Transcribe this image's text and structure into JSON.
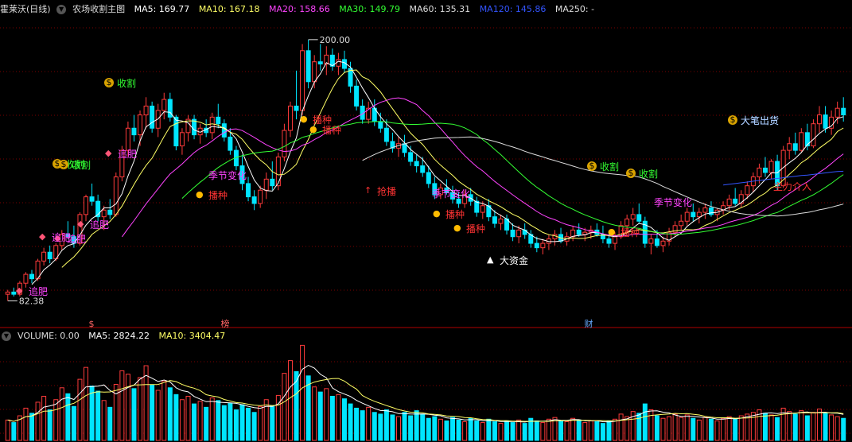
{
  "price_header": {
    "stock_name": "霍莱沃(日线)",
    "indicator": "农场收割主图",
    "ma5": "MA5: 169.77",
    "ma10": "MA10: 167.18",
    "ma20": "MA20: 158.66",
    "ma30": "MA30: 149.79",
    "ma60": "MA60: 135.31",
    "ma120": "MA120: 145.86",
    "ma250": "MA250: -"
  },
  "volume_header": {
    "volume": "VOLUME: 0.00",
    "ma5": "MA5: 2824.22",
    "ma10": "MA10: 3404.47"
  },
  "colors": {
    "background": "#000000",
    "up": "#ff3b3b",
    "down": "#00e5ff",
    "ma5": "#ffffff",
    "ma10": "#ffff66",
    "ma20": "#ff44ff",
    "ma30": "#33ff33",
    "ma60": "#dddddd",
    "ma120": "#3355ff",
    "grid": "#7a0000"
  },
  "chart_data": [
    {
      "type": "candlestick",
      "title": "农场收割主图",
      "ylim": [
        75,
        210
      ],
      "price_labels": {
        "high": "200.00",
        "low": "82.38"
      },
      "candles": [
        [
          85,
          87,
          82,
          86
        ],
        [
          86,
          88,
          84,
          85
        ],
        [
          85,
          91,
          84,
          90
        ],
        [
          90,
          95,
          88,
          94
        ],
        [
          94,
          96,
          90,
          92
        ],
        [
          92,
          101,
          91,
          100
        ],
        [
          100,
          106,
          98,
          104
        ],
        [
          104,
          107,
          99,
          101
        ],
        [
          101,
          108,
          100,
          107
        ],
        [
          107,
          114,
          105,
          112
        ],
        [
          112,
          118,
          110,
          111
        ],
        [
          111,
          116,
          106,
          108
        ],
        [
          108,
          122,
          107,
          121
        ],
        [
          121,
          130,
          118,
          129
        ],
        [
          129,
          135,
          125,
          127
        ],
        [
          127,
          130,
          118,
          120
        ],
        [
          120,
          125,
          114,
          123
        ],
        [
          123,
          128,
          119,
          121
        ],
        [
          121,
          140,
          120,
          138
        ],
        [
          138,
          152,
          136,
          150
        ],
        [
          150,
          163,
          147,
          160
        ],
        [
          160,
          166,
          154,
          157
        ],
        [
          157,
          168,
          152,
          166
        ],
        [
          166,
          174,
          160,
          170
        ],
        [
          170,
          172,
          158,
          160
        ],
        [
          160,
          171,
          156,
          168
        ],
        [
          168,
          176,
          164,
          173
        ],
        [
          173,
          176,
          163,
          165
        ],
        [
          165,
          166,
          150,
          152
        ],
        [
          152,
          160,
          148,
          158
        ],
        [
          158,
          166,
          154,
          164
        ],
        [
          164,
          166,
          155,
          157
        ],
        [
          157,
          162,
          153,
          160
        ],
        [
          160,
          164,
          156,
          158
        ],
        [
          158,
          167,
          155,
          165
        ],
        [
          165,
          171,
          160,
          162
        ],
        [
          162,
          164,
          154,
          156
        ],
        [
          156,
          160,
          148,
          150
        ],
        [
          150,
          152,
          141,
          143
        ],
        [
          143,
          148,
          132,
          135
        ],
        [
          135,
          138,
          127,
          129
        ],
        [
          129,
          132,
          123,
          126
        ],
        [
          126,
          134,
          124,
          132
        ],
        [
          132,
          140,
          128,
          137
        ],
        [
          137,
          145,
          132,
          134
        ],
        [
          134,
          149,
          132,
          147
        ],
        [
          147,
          162,
          145,
          159
        ],
        [
          159,
          172,
          156,
          170
        ],
        [
          170,
          186,
          164,
          168
        ],
        [
          168,
          198,
          166,
          195
        ],
        [
          195,
          200,
          178,
          181
        ],
        [
          181,
          193,
          178,
          190
        ],
        [
          190,
          198,
          186,
          189
        ],
        [
          189,
          197,
          184,
          193
        ],
        [
          193,
          196,
          186,
          188
        ],
        [
          188,
          194,
          184,
          191
        ],
        [
          191,
          195,
          185,
          187
        ],
        [
          187,
          190,
          176,
          179
        ],
        [
          179,
          182,
          168,
          170
        ],
        [
          170,
          173,
          162,
          164
        ],
        [
          164,
          172,
          162,
          169
        ],
        [
          169,
          173,
          161,
          163
        ],
        [
          163,
          167,
          158,
          160
        ],
        [
          160,
          164,
          152,
          154
        ],
        [
          154,
          158,
          149,
          151
        ],
        [
          151,
          156,
          147,
          153
        ],
        [
          153,
          157,
          147,
          149
        ],
        [
          149,
          152,
          143,
          145
        ],
        [
          145,
          148,
          140,
          143
        ],
        [
          143,
          147,
          138,
          140
        ],
        [
          140,
          143,
          133,
          135
        ],
        [
          135,
          138,
          128,
          130
        ],
        [
          130,
          135,
          128,
          133
        ],
        [
          133,
          137,
          130,
          131
        ],
        [
          131,
          134,
          126,
          128
        ],
        [
          128,
          131,
          124,
          126
        ],
        [
          126,
          132,
          124,
          130
        ],
        [
          130,
          133,
          125,
          127
        ],
        [
          127,
          129,
          120,
          122
        ],
        [
          122,
          127,
          119,
          125
        ],
        [
          125,
          128,
          118,
          120
        ],
        [
          120,
          123,
          115,
          117
        ],
        [
          117,
          121,
          114,
          119
        ],
        [
          119,
          121,
          112,
          114
        ],
        [
          114,
          117,
          109,
          111
        ],
        [
          111,
          116,
          108,
          114
        ],
        [
          114,
          117,
          110,
          112
        ],
        [
          112,
          114,
          106,
          108
        ],
        [
          108,
          111,
          104,
          106
        ],
        [
          106,
          110,
          103,
          108
        ],
        [
          108,
          112,
          105,
          110
        ],
        [
          110,
          114,
          107,
          112
        ],
        [
          112,
          115,
          108,
          109
        ],
        [
          109,
          113,
          107,
          111
        ],
        [
          111,
          116,
          109,
          114
        ],
        [
          114,
          117,
          111,
          112
        ],
        [
          112,
          115,
          109,
          113
        ],
        [
          113,
          116,
          110,
          114
        ],
        [
          114,
          117,
          111,
          112
        ],
        [
          112,
          116,
          108,
          110
        ],
        [
          110,
          113,
          106,
          108
        ],
        [
          108,
          113,
          105,
          111
        ],
        [
          111,
          118,
          110,
          116
        ],
        [
          116,
          121,
          113,
          119
        ],
        [
          119,
          124,
          116,
          121
        ],
        [
          121,
          126,
          117,
          118
        ],
        [
          118,
          120,
          106,
          108
        ],
        [
          108,
          112,
          103,
          110
        ],
        [
          110,
          114,
          106,
          107
        ],
        [
          107,
          111,
          104,
          109
        ],
        [
          109,
          115,
          107,
          113
        ],
        [
          113,
          118,
          111,
          116
        ],
        [
          116,
          121,
          114,
          118
        ],
        [
          118,
          124,
          116,
          122
        ],
        [
          122,
          126,
          118,
          120
        ],
        [
          120,
          124,
          117,
          122
        ],
        [
          122,
          126,
          119,
          124
        ],
        [
          124,
          127,
          120,
          121
        ],
        [
          121,
          124,
          118,
          123
        ],
        [
          123,
          127,
          121,
          125
        ],
        [
          125,
          130,
          123,
          128
        ],
        [
          128,
          133,
          125,
          126
        ],
        [
          126,
          132,
          124,
          130
        ],
        [
          130,
          136,
          128,
          134
        ],
        [
          134,
          140,
          131,
          138
        ],
        [
          138,
          144,
          135,
          142
        ],
        [
          142,
          147,
          138,
          140
        ],
        [
          140,
          146,
          137,
          145
        ],
        [
          145,
          148,
          132,
          134
        ],
        [
          134,
          152,
          133,
          150
        ],
        [
          150,
          156,
          146,
          153
        ],
        [
          153,
          158,
          148,
          150
        ],
        [
          150,
          160,
          149,
          158
        ],
        [
          158,
          162,
          150,
          152
        ],
        [
          152,
          164,
          151,
          162
        ],
        [
          162,
          170,
          158,
          166
        ],
        [
          166,
          170,
          158,
          160
        ],
        [
          160,
          168,
          157,
          165
        ],
        [
          165,
          172,
          162,
          169
        ],
        [
          169,
          174,
          163,
          166
        ]
      ],
      "volume": [
        2400,
        2100,
        2900,
        3800,
        3200,
        4500,
        5200,
        3600,
        4800,
        6200,
        5500,
        4000,
        7200,
        8600,
        6400,
        5800,
        4700,
        3900,
        6600,
        8200,
        7800,
        6100,
        7400,
        8800,
        6500,
        5900,
        7000,
        6200,
        5400,
        4800,
        5200,
        4300,
        4600,
        3900,
        5000,
        4700,
        4100,
        4400,
        3600,
        4200,
        3800,
        3300,
        4000,
        4800,
        4100,
        5300,
        7900,
        9400,
        8100,
        11200,
        7600,
        6300,
        5700,
        6100,
        5200,
        5400,
        4900,
        4300,
        3800,
        3500,
        3900,
        3300,
        3100,
        3600,
        3000,
        2800,
        3300,
        2900,
        3500,
        3100,
        2600,
        2800,
        2500,
        2300,
        2700,
        2400,
        2200,
        2600,
        2300,
        2100,
        2500,
        2200,
        2000,
        2300,
        2100,
        2400,
        2000,
        2600,
        2300,
        2100,
        2500,
        2700,
        2300,
        2200,
        2600,
        2400,
        2100,
        2300,
        2200,
        2000,
        2300,
        2500,
        3100,
        2800,
        3400,
        3200,
        4300,
        3600,
        2900,
        2600,
        2800,
        3100,
        2700,
        3000,
        2600,
        2400,
        2700,
        2500,
        2300,
        2600,
        2800,
        2500,
        2900,
        3100,
        3300,
        3600,
        3200,
        3000,
        2700,
        3800,
        3400,
        3100,
        3500,
        2900,
        3300,
        3700,
        3200,
        3000,
        2800,
        2600
      ],
      "ma_series": [
        {
          "name": "MA5",
          "value": 169.77
        },
        {
          "name": "MA10",
          "value": 167.18
        },
        {
          "name": "MA20",
          "value": 158.66
        },
        {
          "name": "MA30",
          "value": 149.79
        },
        {
          "name": "MA60",
          "value": 135.31
        },
        {
          "name": "MA120",
          "value": 145.86
        },
        {
          "name": "MA250",
          "value": "-"
        }
      ],
      "bottom_markers": [
        "$",
        "榜",
        "财"
      ],
      "annotations": [
        {
          "text": "收割",
          "i": 28,
          "price": 124,
          "color": "#33ff33",
          "icon": "money-bag-icon"
        },
        {
          "text": "追肥",
          "i": 30,
          "price": 132,
          "color": "#ff44ff",
          "icon": "diamond-icon"
        },
        {
          "text": "收割",
          "i": 12,
          "price": 164,
          "color": "#33ff33",
          "icon": "money-bag-icon"
        },
        {
          "text": "追肥",
          "i": 6,
          "price": 180,
          "color": "#ff44ff",
          "icon": "diamond-icon"
        },
        {
          "text": "追肥",
          "i": 2,
          "price": 202,
          "color": "#ff44ff",
          "icon": "diamond-icon"
        },
        {
          "text": "收割",
          "i": 2,
          "price": 215,
          "color": "#33ff33",
          "icon": "money-bag-icon"
        },
        {
          "text": "追肥",
          "i": 5,
          "price": 232,
          "color": "#ff44ff",
          "icon": "diamond-icon"
        },
        {
          "text": "追肥",
          "i": 0,
          "price": 298,
          "color": "#ff44ff",
          "icon": "diamond-icon"
        },
        {
          "text": "季节变化",
          "i": 0,
          "price": 220,
          "color": "#ff44ff",
          "icon": ""
        },
        {
          "text": "播种",
          "i": 0,
          "price": 245,
          "color": "#ff3333",
          "icon": "fruit-icon"
        },
        {
          "text": "大笔出货",
          "i": 0,
          "price": 77,
          "color": "#aaccff",
          "icon": "money-bag-icon"
        },
        {
          "text": "播种",
          "i": 0,
          "price": 150,
          "color": "#ff3333",
          "icon": "fruit-icon"
        },
        {
          "text": "播种",
          "i": 0,
          "price": 163,
          "color": "#ff3333",
          "icon": "fruit-icon"
        },
        {
          "text": "抢播",
          "i": 0,
          "price": 240,
          "color": "#ff3333",
          "icon": "arrow-up-icon"
        },
        {
          "text": "季节变化",
          "i": 0,
          "price": 243,
          "color": "#ff44ff",
          "icon": ""
        },
        {
          "text": "播种",
          "i": 0,
          "price": 270,
          "color": "#ff3333",
          "icon": "fruit-icon"
        },
        {
          "text": "播种",
          "i": 0,
          "price": 287,
          "color": "#ff3333",
          "icon": "fruit-icon"
        },
        {
          "text": "大资金",
          "i": 0,
          "price": 327,
          "color": "#ffffff",
          "icon": "triangle-icon"
        },
        {
          "text": "收割",
          "i": 0,
          "price": 209,
          "color": "#33ff33",
          "icon": "money-bag-icon"
        },
        {
          "text": "收割",
          "i": 0,
          "price": 218,
          "color": "#33ff33",
          "icon": "money-bag-icon"
        },
        {
          "text": "季节变化",
          "i": 0,
          "price": 254,
          "color": "#ff44ff",
          "icon": ""
        },
        {
          "text": "播种",
          "i": 0,
          "price": 292,
          "color": "#ff3333",
          "icon": "fruit-icon"
        },
        {
          "text": "大笔出货",
          "i": 0,
          "price": 151,
          "color": "#aaccff",
          "icon": ""
        },
        {
          "text": "主力介入",
          "i": 0,
          "price": 234,
          "color": "#ff3333",
          "icon": ""
        }
      ]
    }
  ]
}
